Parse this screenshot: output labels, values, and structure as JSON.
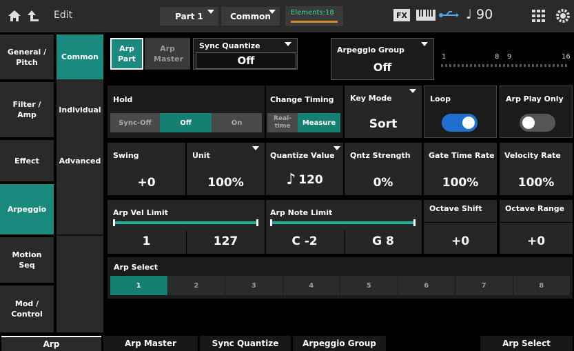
{
  "header": {
    "edit_label": "Edit",
    "part_label": "Part 1",
    "common_tab": "Common",
    "elements_label": "Elements:18",
    "fx_badge": "FX",
    "tempo": "♩ 90",
    "icons": [
      "home-icon",
      "back-icon",
      "keyboard-icon",
      "usb-icon",
      "grid-icon",
      "settings-icon"
    ]
  },
  "sidebar1": [
    {
      "label": "General / Pitch"
    },
    {
      "label": "Filter / Amp"
    },
    {
      "label": "Effect"
    },
    {
      "label": "Arpeggio",
      "active": true
    },
    {
      "label": "Motion Seq"
    },
    {
      "label": "Mod / Control"
    }
  ],
  "sidebar2": [
    {
      "label": "Common",
      "active": true
    },
    {
      "label": "Individual"
    },
    {
      "label": "Advanced"
    }
  ],
  "top": {
    "arp_part": "Arp Part",
    "arp_master": "Arp Master",
    "sync_quantize_label": "Sync Quantize",
    "sync_quantize_value": "Off",
    "arp_group_label": "Arpeggio Group",
    "arp_group_value": "Off",
    "scale_1": "1",
    "scale_8": "8",
    "scale_9": "9",
    "scale_16": "16"
  },
  "row1": {
    "hold_label": "Hold",
    "hold_options": [
      "Sync-Off",
      "Off",
      "On"
    ],
    "change_timing_label": "Change Timing",
    "change_timing_options": [
      "Real-time",
      "Measure"
    ],
    "key_mode_label": "Key Mode",
    "key_mode_value": "Sort",
    "loop_label": "Loop",
    "loop_on": true,
    "arp_play_only_label": "Arp Play Only",
    "arp_play_only_on": false
  },
  "row2": {
    "swing_label": "Swing",
    "swing_value": "+0",
    "unit_label": "Unit",
    "unit_value": "100%",
    "quantize_label": "Quantize Value",
    "quantize_value": "120",
    "qntz_strength_label": "Qntz Strength",
    "qntz_strength_value": "0%",
    "gate_time_label": "Gate Time Rate",
    "gate_time_value": "100%",
    "velocity_rate_label": "Velocity Rate",
    "velocity_rate_value": "100%"
  },
  "row3": {
    "vel_limit_label": "Arp Vel Limit",
    "vel_low": "1",
    "vel_high": "127",
    "note_limit_label": "Arp Note Limit",
    "note_low": "C -2",
    "note_high": "G 8",
    "octave_shift_label": "Octave Shift",
    "octave_shift_value": "+0",
    "octave_range_label": "Octave Range",
    "octave_range_value": "+0"
  },
  "arp_select": {
    "label": "Arp Select",
    "items": [
      "1",
      "2",
      "3",
      "4",
      "5",
      "6",
      "7",
      "8"
    ],
    "selected": "1"
  },
  "bottom": [
    "Arp",
    "Arp Master",
    "Sync Quantize",
    "Arpeggio Group",
    "Arp Select"
  ],
  "colors": {
    "accent": "#1a8a7e",
    "toggle": "#1f6fd1",
    "bar": "#1fb29d"
  }
}
